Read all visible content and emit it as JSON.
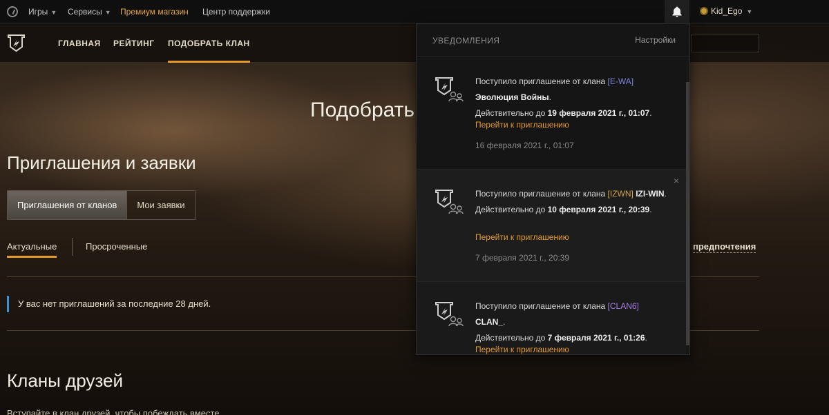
{
  "topbar": {
    "games": "Игры",
    "services": "Сервисы",
    "premium": "Премиум магазин",
    "support": "Центр поддержки",
    "username": "Kid_Ego"
  },
  "clannav": {
    "items": [
      "ГЛАВНАЯ",
      "РЕЙТИНГ",
      "ПОДОБРАТЬ КЛАН"
    ]
  },
  "main": {
    "title": "Подобрать к",
    "invites_title": "Приглашения и заявки",
    "tabs": [
      "Приглашения от кланов",
      "Мои заявки"
    ],
    "filters": [
      "Актуальные",
      "Просроченные"
    ],
    "preferences": "предпочтения",
    "notice": "У вас нет приглашений за последние 28 дней.",
    "friends_title": "Кланы друзей",
    "friends_sub": "Вступайте в клан друзей, чтобы побеждать вместе"
  },
  "notifications": {
    "title": "УВЕДОМЛЕНИЯ",
    "settings": "Настройки",
    "close_glyph": "×",
    "items": [
      {
        "prefix": "Поступило приглашение от клана",
        "tag": "[E-WA]",
        "clan_name": "Эволюция Войны",
        "valid_prefix": "Действительно до",
        "valid_date": "19 февраля 2021 г., 01:07",
        "link": "Перейти к приглашению",
        "date": "16 февраля 2021 г., 01:07"
      },
      {
        "prefix": "Поступило приглашение от клана",
        "tag": "[IZWN]",
        "clan_name": "IZI-WIN",
        "valid_prefix": "Действительно до",
        "valid_date": "10 февраля 2021 г., 20:39",
        "link": "Перейти к приглашению",
        "date": "7 февраля 2021 г., 20:39"
      },
      {
        "prefix": "Поступило приглашение от клана",
        "tag": "[CLAN6]",
        "clan_name": "CLAN_",
        "valid_prefix": "Действительно до",
        "valid_date": "7 февраля 2021 г., 01:26",
        "link": "Перейти к приглашению",
        "date": ""
      }
    ]
  },
  "colors": {
    "accent": "#e59a2b",
    "tag_blue": "#7e84d6",
    "tag_gold": "#cfa64b",
    "tag_violet": "#a67ee3",
    "notice_bar": "#3d8fd6"
  }
}
